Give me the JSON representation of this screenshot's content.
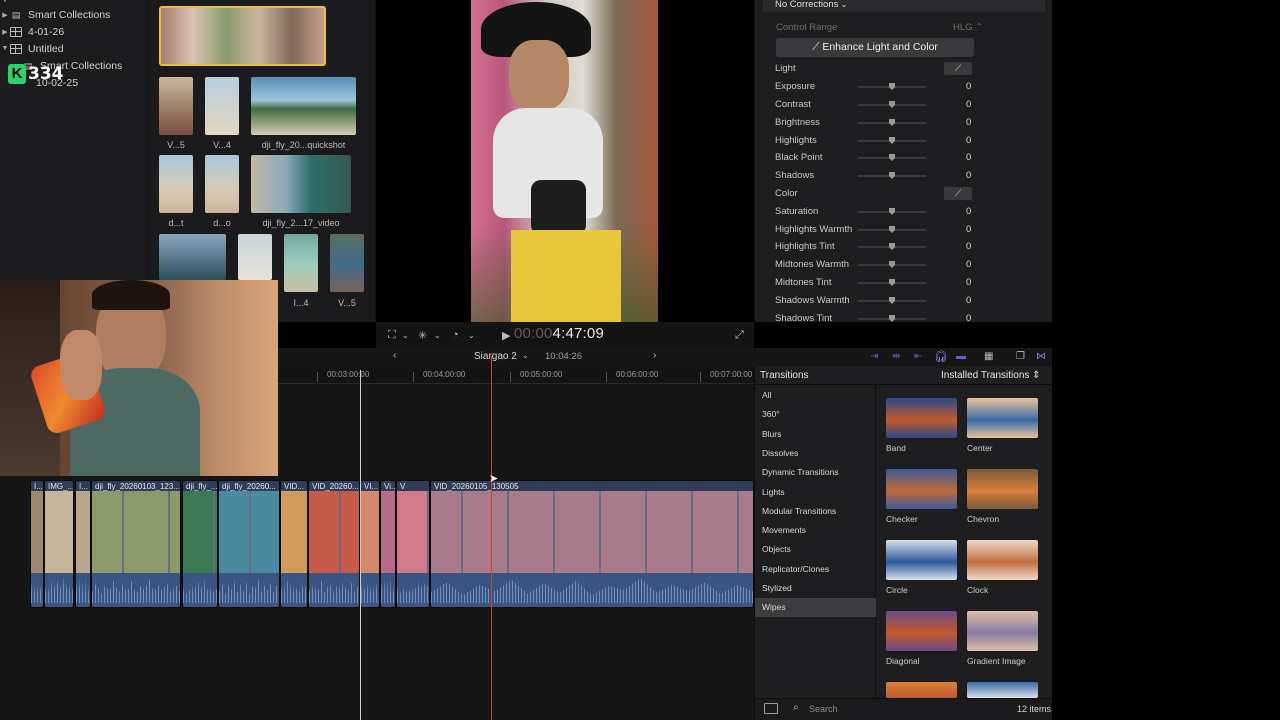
{
  "library": {
    "items": [
      {
        "label": "Smart Collections"
      },
      {
        "label": "4-01-26"
      },
      {
        "label": "Untitled"
      },
      {
        "label": "Smart Collections"
      },
      {
        "label": "10-02-25"
      }
    ],
    "overlay_badge": {
      "letter": "K",
      "count": "334"
    }
  },
  "browser": {
    "clips": [
      {
        "label": "V...5"
      },
      {
        "label": "V...4"
      },
      {
        "label": "dji_fly_20...quickshot"
      },
      {
        "label": "d...t"
      },
      {
        "label": "d...o"
      },
      {
        "label": "dji_fly_2...17_video"
      },
      {
        "label": "I...4"
      },
      {
        "label": "V...5"
      }
    ]
  },
  "viewer": {
    "timecode_dim": "00:00",
    "timecode": "4:47:09"
  },
  "inspector": {
    "corrections": "No Corrections",
    "control_range_label": "Control Range",
    "control_range_value": "HLG",
    "enhance_button": "Enhance Light and Color",
    "sections": [
      {
        "label": "Light",
        "header": true
      },
      {
        "label": "Exposure",
        "value": "0"
      },
      {
        "label": "Contrast",
        "value": "0"
      },
      {
        "label": "Brightness",
        "value": "0"
      },
      {
        "label": "Highlights",
        "value": "0"
      },
      {
        "label": "Black Point",
        "value": "0"
      },
      {
        "label": "Shadows",
        "value": "0"
      },
      {
        "label": "Color",
        "header": true
      },
      {
        "label": "Saturation",
        "value": "0"
      },
      {
        "label": "Highlights Warmth",
        "value": "0"
      },
      {
        "label": "Highlights Tint",
        "value": "0"
      },
      {
        "label": "Midtones Warmth",
        "value": "0"
      },
      {
        "label": "Midtones Tint",
        "value": "0"
      },
      {
        "label": "Shadows Warmth",
        "value": "0"
      },
      {
        "label": "Shadows Tint",
        "value": "0"
      }
    ]
  },
  "timeline": {
    "project": "Siargao 2",
    "duration": "10:04:26",
    "ruler": [
      "00:03:00:00",
      "00:04:00:00",
      "00:05:00:00",
      "00:06:00:00",
      "00:07:00:00"
    ],
    "clips": [
      {
        "name": "I..."
      },
      {
        "name": "IMG_..."
      },
      {
        "name": "I..."
      },
      {
        "name": "dji_fly_20260103_123..."
      },
      {
        "name": "dji_fly_..."
      },
      {
        "name": "dji_fly_20260..."
      },
      {
        "name": "VID..."
      },
      {
        "name": "VID_20260..."
      },
      {
        "name": "VI..."
      },
      {
        "name": "Vi..."
      },
      {
        "name": "V"
      },
      {
        "name": "VID_20260105_130505"
      }
    ]
  },
  "transitions": {
    "title": "Transitions",
    "installed": "Installed Transitions",
    "categories": [
      "All",
      "360°",
      "Blurs",
      "Dissolves",
      "Dynamic Transitions",
      "Lights",
      "Modular Transitions",
      "Movements",
      "Objects",
      "Replicator/Clones",
      "Stylized",
      "Wipes"
    ],
    "selected_category": "Wipes",
    "items": [
      "Band",
      "Center",
      "Checker",
      "Chevron",
      "Circle",
      "Clock",
      "Diagonal",
      "Gradient Image"
    ],
    "search_placeholder": "Search",
    "count": "12 items"
  }
}
